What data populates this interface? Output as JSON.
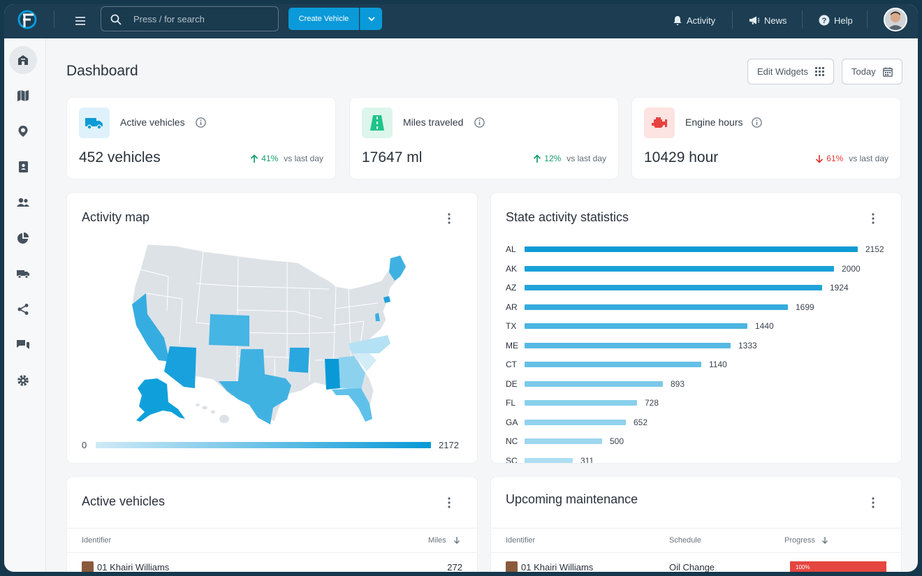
{
  "topbar": {
    "search_placeholder": "Press / for search",
    "create_label": "Create Vehicle",
    "activity_label": "Activity",
    "news_label": "News",
    "help_label": "Help"
  },
  "sidebar": {
    "items": [
      "home-icon",
      "map-icon",
      "location-icon",
      "contacts-icon",
      "users-icon",
      "reports-icon",
      "vehicles-icon",
      "share-icon",
      "messages-icon",
      "settings-icon"
    ],
    "active": "home-icon"
  },
  "page": {
    "title": "Dashboard",
    "edit_widgets_label": "Edit Widgets",
    "date_label": "Today"
  },
  "kpis": [
    {
      "label": "Active vehicles",
      "value": "452 vehicles",
      "pct": "41%",
      "trend": "up",
      "vs": "vs last day",
      "accent": "#0d9bd6",
      "bg": "#dff2fb"
    },
    {
      "label": "Miles traveled",
      "value": "17647 ml",
      "pct": "12%",
      "trend": "up",
      "vs": "vs last day",
      "accent": "#1fc48b",
      "bg": "#dcf6ec"
    },
    {
      "label": "Engine hours",
      "value": "10429 hour",
      "pct": "61%",
      "trend": "down",
      "vs": "vs last day",
      "accent": "#e8423f",
      "bg": "#fde3e2"
    }
  ],
  "activity_map": {
    "title": "Activity map",
    "legend_min": "0",
    "legend_max": "2172"
  },
  "state_stats": {
    "title": "State activity statistics",
    "rows": [
      {
        "code": "AL",
        "value": 2152
      },
      {
        "code": "AK",
        "value": 2000
      },
      {
        "code": "AZ",
        "value": 1924
      },
      {
        "code": "AR",
        "value": 1699
      },
      {
        "code": "TX",
        "value": 1440
      },
      {
        "code": "ME",
        "value": 1333
      },
      {
        "code": "CT",
        "value": 1140
      },
      {
        "code": "DE",
        "value": 893
      },
      {
        "code": "FL",
        "value": 728
      },
      {
        "code": "GA",
        "value": 652
      },
      {
        "code": "NC",
        "value": 500
      },
      {
        "code": "SC",
        "value": 311
      }
    ]
  },
  "active_vehicles": {
    "title": "Active vehicles",
    "col_identifier": "Identifier",
    "col_miles": "Miles",
    "rows": [
      {
        "identifier": "01 Khairi Williams",
        "miles": "272"
      }
    ]
  },
  "maintenance": {
    "title": "Upcoming maintenance",
    "col_identifier": "Identifier",
    "col_schedule": "Schedule",
    "col_progress": "Progress",
    "rows": [
      {
        "identifier": "01 Khairi Williams",
        "schedule": "Oil Change",
        "progress": "100%"
      }
    ]
  }
}
